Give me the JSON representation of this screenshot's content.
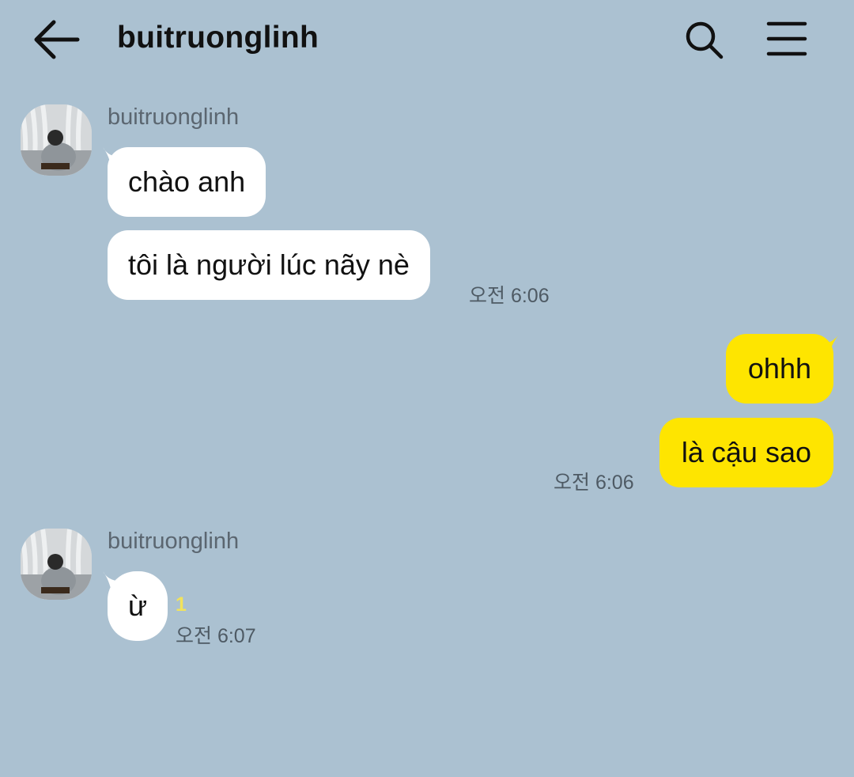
{
  "header": {
    "title": "buitruonglinh",
    "back_icon": "arrow-left-icon",
    "search_icon": "search-icon",
    "menu_icon": "hamburger-menu-icon"
  },
  "colors": {
    "background": "#abc1d1",
    "incoming_bubble": "#ffffff",
    "outgoing_bubble": "#fee500",
    "unread_badge": "#f2e35b"
  },
  "groups": [
    {
      "sender": "buitruonglinh",
      "messages": [
        {
          "text": "chào anh"
        },
        {
          "text": "tôi là người lúc nãy nè",
          "time": "오전 6:06"
        }
      ]
    },
    {
      "sender": "me",
      "messages": [
        {
          "text": "ohhh"
        },
        {
          "text": "là cậu sao",
          "time": "오전 6:06"
        }
      ]
    },
    {
      "sender": "buitruonglinh",
      "messages": [
        {
          "text": "ừ",
          "unread": "1",
          "time": "오전 6:07"
        }
      ]
    }
  ]
}
